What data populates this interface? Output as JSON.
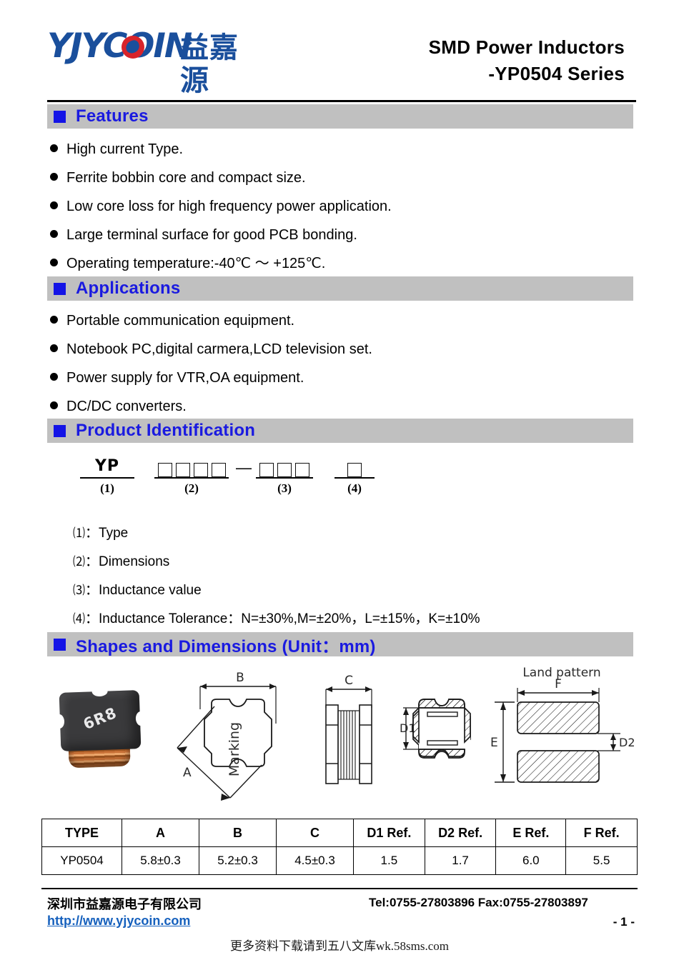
{
  "header": {
    "logo_text": "YJYCOIN",
    "logo_cn": "益嘉源",
    "title_line1": "SMD Power Inductors",
    "title_line2": "-YP0504 Series",
    "brand_blue": "#1a4f9c",
    "brand_red": "#d8232a"
  },
  "sections": {
    "features": {
      "title": "Features",
      "items": [
        "High current Type.",
        "Ferrite bobbin core and compact size.",
        "Low core loss for high frequency power application.",
        "Large terminal surface for good PCB bonding.",
        "Operating temperature:-40℃ ～ +125℃."
      ]
    },
    "applications": {
      "title": "Applications",
      "items": [
        "Portable communication equipment.",
        "Notebook PC,digital carmera,LCD television set.",
        "Power supply for VTR,OA equipment.",
        "DC/DC converters."
      ]
    },
    "product_identification": {
      "title": "Product Identification",
      "part_code": {
        "group1_text": "YP",
        "group1_label": "(1)",
        "group2_boxes": 4,
        "group2_label": "(2)",
        "separator": "—",
        "group3_boxes": 3,
        "group3_label": "(3)",
        "group4_boxes": 1,
        "group4_label": "(4)"
      },
      "legend": [
        {
          "num": "⑴",
          "sep": "：",
          "text": "Type"
        },
        {
          "num": "⑵",
          "sep": "：",
          "text": "Dimensions"
        },
        {
          "num": "⑶",
          "sep": "：",
          "text": "Inductance value"
        },
        {
          "num": "⑷",
          "sep": "：",
          "text": "Inductance Tolerance：N=±30%,M=±20%，L=±15%，K=±10%"
        }
      ]
    },
    "shapes": {
      "title": "Shapes and Dimensions (Unit：mm)",
      "photo_marking": "6R8",
      "drawing_labels": {
        "a": "A",
        "b": "B",
        "c": "C",
        "d1": "D1",
        "d2": "D2",
        "e": "E",
        "f": "F",
        "marking": "Marking",
        "land_pattern": "Land pattern"
      }
    }
  },
  "table": {
    "headers": [
      "TYPE",
      "A",
      "B",
      "C",
      "D1 Ref.",
      "D2 Ref.",
      "E Ref.",
      "F Ref."
    ],
    "rows": [
      [
        "YP0504",
        "5.8±0.3",
        "5.2±0.3",
        "4.5±0.3",
        "1.5",
        "1.7",
        "6.0",
        "5.5"
      ]
    ]
  },
  "footer": {
    "company": "深圳市益嘉源电子有限公司",
    "url": "http://www.yjycoin.com",
    "contact": "Tel:0755-27803896   Fax:0755-27803897",
    "page": "- 1 -",
    "watermark": "更多资料下载请到五八文库wk.58sms.com",
    "link_color": "#1560bd"
  }
}
